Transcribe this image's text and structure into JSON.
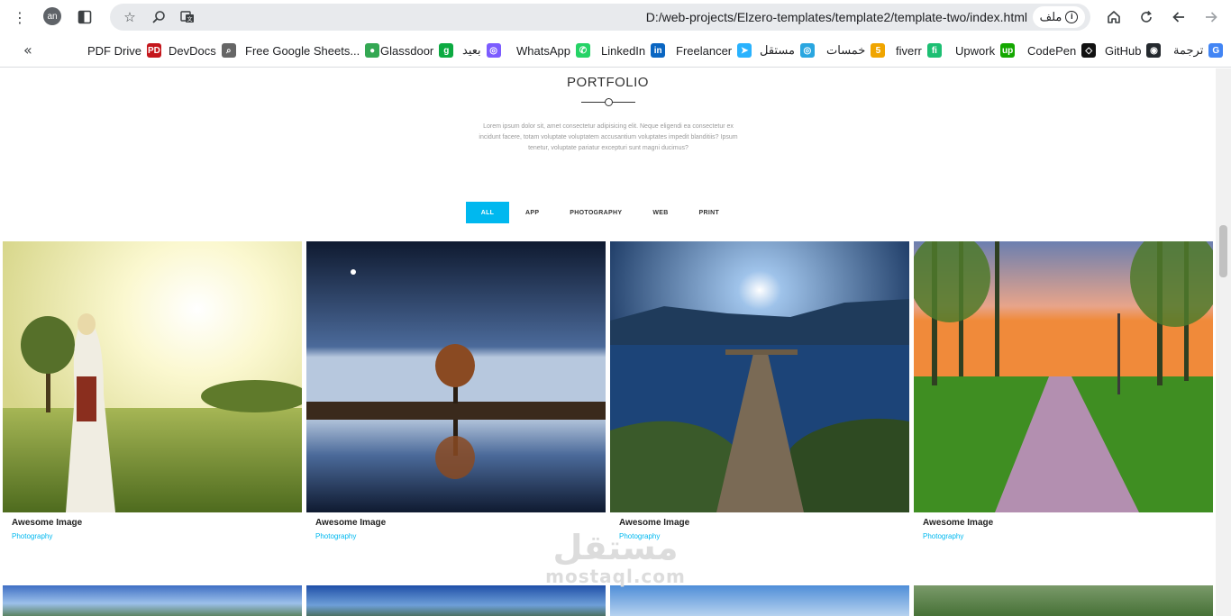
{
  "browser": {
    "url": "D:/web-projects/Elzero-templates/template2/template-two/index.html",
    "site_chip_label": "ملف",
    "avatar_initials": "an"
  },
  "bookmarks": [
    {
      "label": "ترجمة",
      "icon": "google-translate-icon",
      "color": "#4285f4",
      "glyph": "G"
    },
    {
      "label": "GitHub",
      "icon": "github-icon",
      "color": "#24292e",
      "glyph": "◉"
    },
    {
      "label": "CodePen",
      "icon": "codepen-icon",
      "color": "#111111",
      "glyph": "◇"
    },
    {
      "label": "Upwork",
      "icon": "upwork-icon",
      "color": "#14a800",
      "glyph": "up"
    },
    {
      "label": "fiverr",
      "icon": "fiverr-icon",
      "color": "#1dbf73",
      "glyph": "fi"
    },
    {
      "label": "خمسات",
      "icon": "khamsat-icon",
      "color": "#f0a500",
      "glyph": "5"
    },
    {
      "label": "مستقل",
      "icon": "mostaql-icon",
      "color": "#2aa6e0",
      "glyph": "◎"
    },
    {
      "label": "Freelancer",
      "icon": "freelancer-icon",
      "color": "#29b2fe",
      "glyph": "➤"
    },
    {
      "label": "LinkedIn",
      "icon": "linkedin-icon",
      "color": "#0a66c2",
      "glyph": "in"
    },
    {
      "label": "WhatsApp",
      "icon": "whatsapp-icon",
      "color": "#25d366",
      "glyph": "✆"
    },
    {
      "label": "بعيد",
      "icon": "baeed-icon",
      "color": "#7c5cff",
      "glyph": "◎"
    },
    {
      "label": "Glassdoor",
      "icon": "glassdoor-icon",
      "color": "#0caa41",
      "glyph": "g"
    },
    {
      "label": "Free Google Sheets...",
      "icon": "sheets-icon",
      "color": "#34a853",
      "glyph": "●"
    },
    {
      "label": "DevDocs",
      "icon": "devdocs-icon",
      "color": "#666666",
      "glyph": "⌕"
    },
    {
      "label": "PDF Drive",
      "icon": "pdfdrive-icon",
      "color": "#c4161c",
      "glyph": "PD"
    }
  ],
  "portfolio": {
    "title": "PORTFOLIO",
    "description": "Lorem ipsum dolor sit, amet consectetur adipisicing elit. Neque eligendi ea consectetur ex incidunt facere, totam voluptate voluptatem accusantium voluptates impedit blanditiis? Ipsum tenetur, voluptate pariatur excepturi sunt magni ducimus?",
    "filters": [
      "ALL",
      "APP",
      "PHOTOGRAPHY",
      "WEB",
      "PRINT"
    ],
    "items": [
      {
        "title": "Awesome Image",
        "category": "Photography",
        "image": "girl-in-meadow"
      },
      {
        "title": "Awesome Image",
        "category": "Photography",
        "image": "tree-reflection-night"
      },
      {
        "title": "Awesome Image",
        "category": "Photography",
        "image": "pier-lake-moon"
      },
      {
        "title": "Awesome Image",
        "category": "Photography",
        "image": "forest-path-sunset"
      }
    ]
  },
  "watermark": {
    "arabic": "مستقل",
    "latin": "mostaql.com"
  }
}
